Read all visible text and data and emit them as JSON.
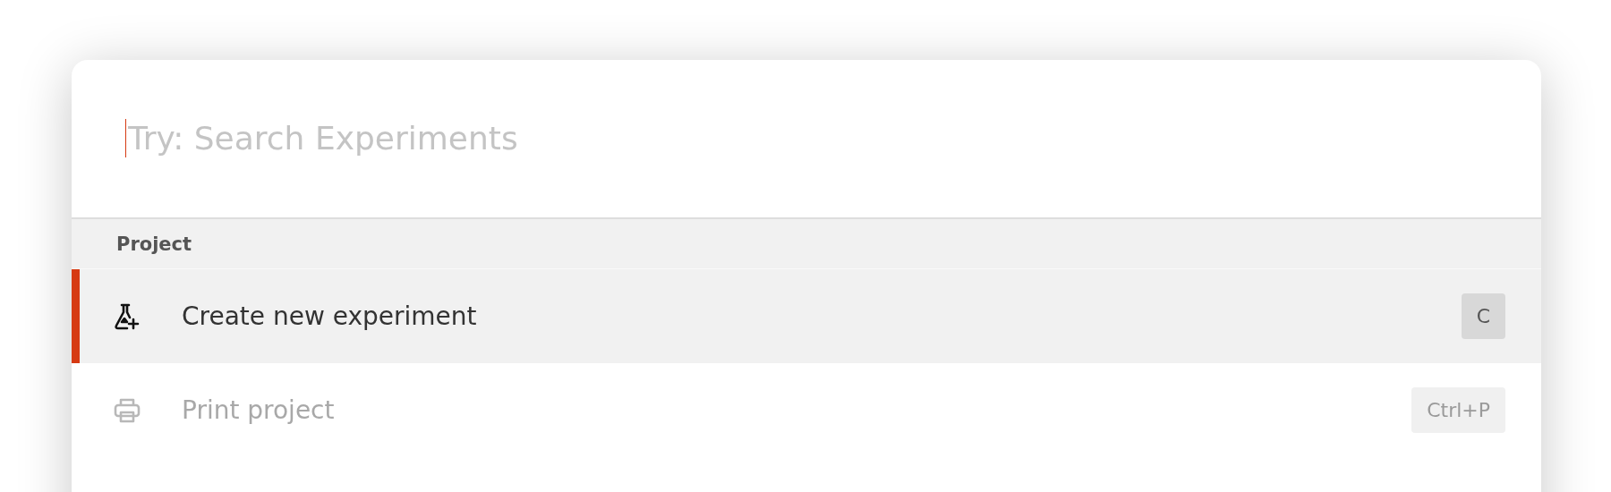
{
  "search": {
    "placeholder": "Try: Search Experiments"
  },
  "section": {
    "title": "Project",
    "items": [
      {
        "label": "Create new experiment",
        "shortcut": "C",
        "selected": true,
        "disabled": false
      },
      {
        "label": "Print project",
        "shortcut": "Ctrl+P",
        "selected": false,
        "disabled": true
      }
    ]
  }
}
